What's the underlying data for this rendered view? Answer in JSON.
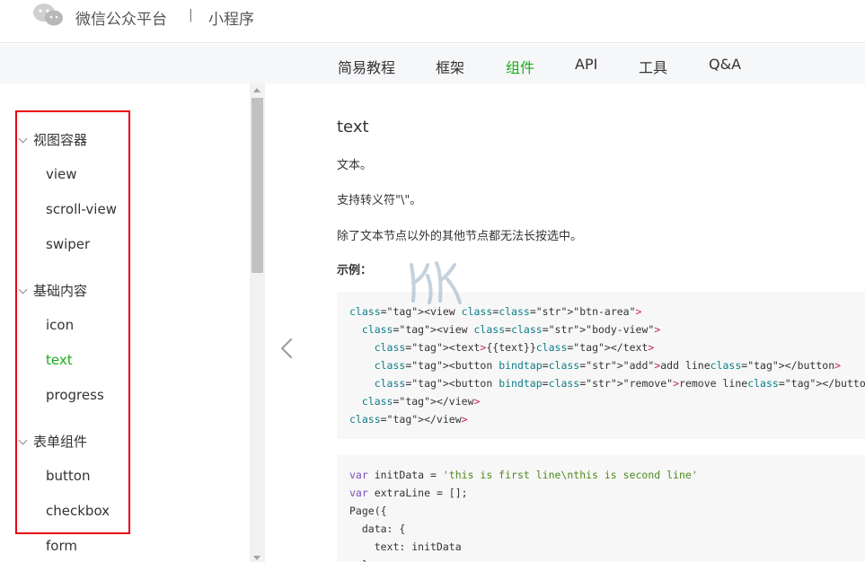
{
  "header": {
    "brand": "微信公众平台",
    "separator": "|",
    "product": "小程序"
  },
  "nav": {
    "items": [
      {
        "label": "简易教程"
      },
      {
        "label": "框架"
      },
      {
        "label": "组件"
      },
      {
        "label": "API"
      },
      {
        "label": "工具"
      },
      {
        "label": "Q&A"
      }
    ],
    "active": "组件"
  },
  "sidebar": {
    "groups": [
      {
        "label": "视图容器",
        "items": [
          "view",
          "scroll-view",
          "swiper"
        ]
      },
      {
        "label": "基础内容",
        "items": [
          "icon",
          "text",
          "progress"
        ]
      },
      {
        "label": "表单组件",
        "items": [
          "button",
          "checkbox",
          "form"
        ]
      }
    ],
    "active_item": "text"
  },
  "content": {
    "title": "text",
    "paragraphs": [
      "文本。",
      "支持转义符\"\\\"。",
      "除了文本节点以外的其他节点都无法长按选中。"
    ],
    "example_label": "示例：",
    "code_block_1": [
      "<view class=\"btn-area\">",
      "  <view class=\"body-view\">",
      "    <text>{{text}}</text>",
      "    <button bindtap=\"add\">add line</button>",
      "    <button bindtap=\"remove\">remove line</button>",
      "  </view>",
      "</view>"
    ],
    "code_block_2": [
      "var initData = 'this is first line\\nthis is second line'",
      "var extraLine = [];",
      "Page({",
      "  data: {",
      "    text: initData",
      "  },"
    ]
  },
  "colors": {
    "accent": "#1aad19",
    "highlight_box": "#e60012",
    "nav_bg": "#f6f7f9",
    "code_bg": "#f7f7f7"
  }
}
